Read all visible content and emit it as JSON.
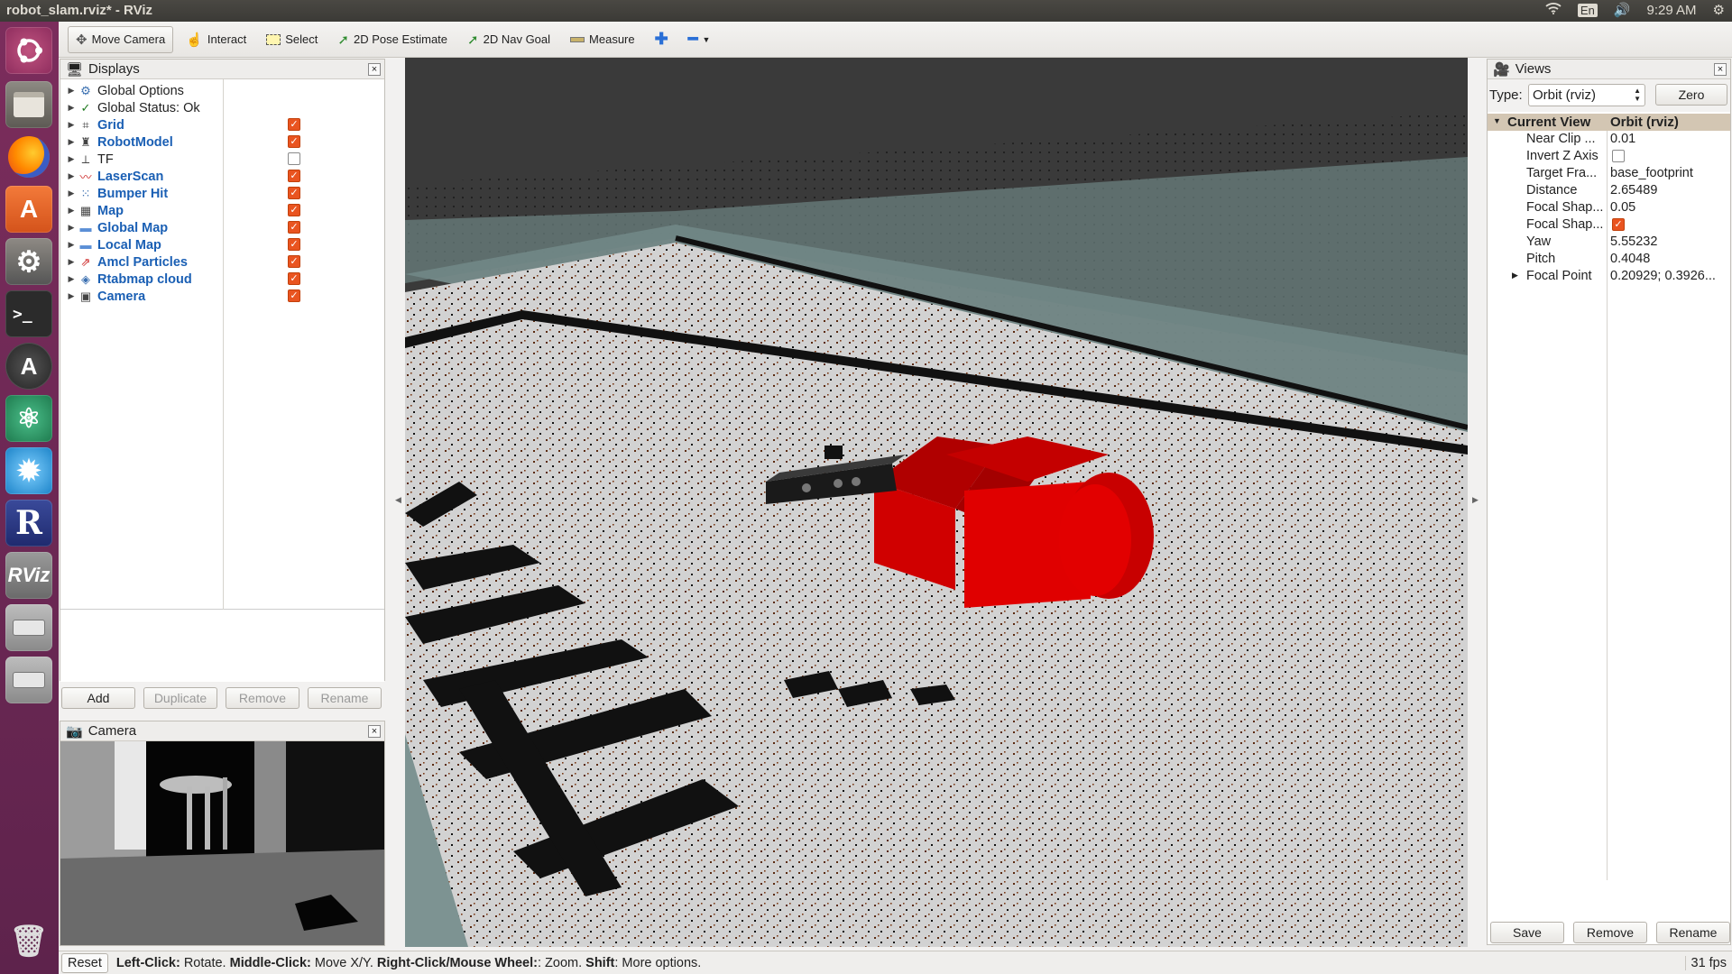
{
  "window": {
    "title": "robot_slam.rviz* - RViz"
  },
  "system_tray": {
    "keyboard": "En",
    "time": "9:29 AM",
    "icons": [
      "wifi-icon",
      "volume-icon",
      "settings-gear-icon"
    ]
  },
  "launcher": {
    "items": [
      "ubuntu-dash",
      "files",
      "firefox",
      "software-center",
      "system-settings",
      "terminal",
      "software-updater",
      "atom",
      "kde-app",
      "r-studio",
      "rviz",
      "drive",
      "drive",
      "trash"
    ],
    "rviz_label": "RViz",
    "r_label": "R"
  },
  "toolbar": {
    "tools": [
      {
        "label": "Move Camera",
        "icon": "move-camera-icon",
        "active": true
      },
      {
        "label": "Interact",
        "icon": "hand-icon"
      },
      {
        "label": "Select",
        "icon": "select-icon"
      },
      {
        "label": "2D Pose Estimate",
        "icon": "pose-arrow-icon"
      },
      {
        "label": "2D Nav Goal",
        "icon": "nav-arrow-icon"
      },
      {
        "label": "Measure",
        "icon": "ruler-icon"
      }
    ]
  },
  "displays": {
    "title": "Displays",
    "items": [
      {
        "label": "Global Options",
        "icon": "gear-icon",
        "checked": null,
        "bold": false
      },
      {
        "label": "Global Status: Ok",
        "icon": "check-icon",
        "checked": null,
        "bold": false
      },
      {
        "label": "Grid",
        "icon": "grid-icon",
        "checked": true,
        "bold": true
      },
      {
        "label": "RobotModel",
        "icon": "robot-icon",
        "checked": true,
        "bold": true
      },
      {
        "label": "TF",
        "icon": "tf-icon",
        "checked": false,
        "bold": false
      },
      {
        "label": "LaserScan",
        "icon": "laser-icon",
        "checked": true,
        "bold": true
      },
      {
        "label": "Bumper Hit",
        "icon": "points-icon",
        "checked": true,
        "bold": true
      },
      {
        "label": "Map",
        "icon": "map-icon",
        "checked": true,
        "bold": true
      },
      {
        "label": "Global Map",
        "icon": "folder-icon",
        "checked": true,
        "bold": true
      },
      {
        "label": "Local Map",
        "icon": "folder-icon",
        "checked": true,
        "bold": true
      },
      {
        "label": "Amcl Particles",
        "icon": "particles-icon",
        "checked": true,
        "bold": true
      },
      {
        "label": "Rtabmap cloud",
        "icon": "cloud-icon",
        "checked": true,
        "bold": true
      },
      {
        "label": "Camera",
        "icon": "camera-icon",
        "checked": true,
        "bold": true
      }
    ],
    "buttons": {
      "add": "Add",
      "duplicate": "Duplicate",
      "remove": "Remove",
      "rename": "Rename"
    }
  },
  "camera_panel": {
    "title": "Camera"
  },
  "views": {
    "title": "Views",
    "type_label": "Type:",
    "type_value": "Orbit (rviz)",
    "zero": "Zero",
    "header": {
      "key": "Current View",
      "value": "Orbit (rviz)"
    },
    "rows": [
      {
        "key": "Near Clip ...",
        "value": "0.01"
      },
      {
        "key": "Invert Z Axis",
        "value": "",
        "checkbox": false
      },
      {
        "key": "Target Fra...",
        "value": "base_footprint"
      },
      {
        "key": "Distance",
        "value": "2.65489"
      },
      {
        "key": "Focal Shap...",
        "value": "0.05"
      },
      {
        "key": "Focal Shap...",
        "value": "",
        "checkbox": true
      },
      {
        "key": "Yaw",
        "value": "5.55232"
      },
      {
        "key": "Pitch",
        "value": "0.4048"
      },
      {
        "key": "Focal Point",
        "value": "0.20929; 0.3926..."
      }
    ],
    "buttons": {
      "save": "Save",
      "remove": "Remove",
      "rename": "Rename"
    }
  },
  "statusbar": {
    "reset": "Reset",
    "l1": "Left-Click:",
    "t1": " Rotate. ",
    "l2": "Middle-Click:",
    "t2": " Move X/Y. ",
    "l3": "Right-Click/Mouse Wheel:",
    "t3": ": Zoom. ",
    "l4": "Shift",
    "t4": ": More options.",
    "fps": "31 fps"
  },
  "colors": {
    "accent": "#e95420",
    "robot": "#cc0000",
    "launcher": "#6a2753",
    "link": "#1a5fb4"
  }
}
